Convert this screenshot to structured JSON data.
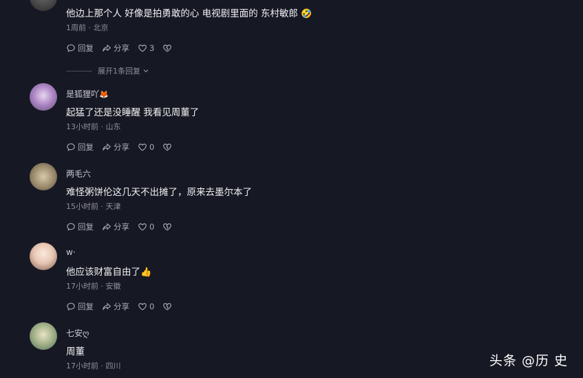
{
  "comments": [
    {
      "name": "",
      "text": "他边上那个人 好像是拍勇敢的心 电视剧里面的 东村敏郎",
      "emoji": "🤣",
      "time": "1周前",
      "location": "北京",
      "reply_label": "回复",
      "share_label": "分享",
      "likes": "3"
    },
    {
      "name": "是狐狸吖",
      "name_emoji": "🦊",
      "text": "起猛了还是没睡醒 我看见周董了",
      "time": "13小时前",
      "location": "山东",
      "reply_label": "回复",
      "share_label": "分享",
      "likes": "0"
    },
    {
      "name": "两毛六",
      "text": "难怪粥饼伦这几天不出摊了，原来去墨尔本了",
      "time": "15小时前",
      "location": "天津",
      "reply_label": "回复",
      "share_label": "分享",
      "likes": "0"
    },
    {
      "name": "w·",
      "text": "他应该财富自由了",
      "emoji": "👍",
      "time": "17小时前",
      "location": "安徽",
      "reply_label": "回复",
      "share_label": "分享",
      "likes": "0"
    },
    {
      "name": "七安ღ",
      "text": "周董",
      "time": "17小时前",
      "location": "四川"
    }
  ],
  "expand_replies": "展开1条回复",
  "watermark": "头条 @历 史",
  "colors": {
    "background": "#161823",
    "text": "#f2f2f4",
    "meta": "#8f909a"
  }
}
